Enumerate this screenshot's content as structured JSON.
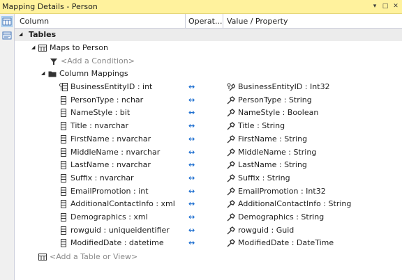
{
  "window": {
    "title": "Mapping Details - Person"
  },
  "toolbar": {
    "left_icons": [
      "map-entity-to-tables-icon",
      "map-entity-to-functions-icon"
    ]
  },
  "columns": {
    "column": "Column",
    "operator": "Operat...",
    "value": "Value / Property"
  },
  "tree": {
    "tables_label": "Tables",
    "maps_to_label": "Maps to Person",
    "add_condition": "<Add a Condition>",
    "column_mappings_label": "Column Mappings",
    "add_table": "<Add a Table or View>"
  },
  "mappings": [
    {
      "column": "BusinessEntityID : int",
      "operator": "↔",
      "property": "BusinessEntityID : Int32",
      "key": true
    },
    {
      "column": "PersonType : nchar",
      "operator": "↔",
      "property": "PersonType : String",
      "key": false
    },
    {
      "column": "NameStyle : bit",
      "operator": "↔",
      "property": "NameStyle : Boolean",
      "key": false
    },
    {
      "column": "Title : nvarchar",
      "operator": "↔",
      "property": "Title : String",
      "key": false
    },
    {
      "column": "FirstName : nvarchar",
      "operator": "↔",
      "property": "FirstName : String",
      "key": false
    },
    {
      "column": "MiddleName : nvarchar",
      "operator": "↔",
      "property": "MiddleName : String",
      "key": false
    },
    {
      "column": "LastName : nvarchar",
      "operator": "↔",
      "property": "LastName : String",
      "key": false
    },
    {
      "column": "Suffix : nvarchar",
      "operator": "↔",
      "property": "Suffix : String",
      "key": false
    },
    {
      "column": "EmailPromotion : int",
      "operator": "↔",
      "property": "EmailPromotion : Int32",
      "key": false
    },
    {
      "column": "AdditionalContactInfo : xml",
      "operator": "↔",
      "property": "AdditionalContactInfo : String",
      "key": false
    },
    {
      "column": "Demographics : xml",
      "operator": "↔",
      "property": "Demographics : String",
      "key": false
    },
    {
      "column": "rowguid : uniqueidentifier",
      "operator": "↔",
      "property": "rowguid : Guid",
      "key": false
    },
    {
      "column": "ModifiedDate : datetime",
      "operator": "↔",
      "property": "ModifiedDate : DateTime",
      "key": false
    }
  ],
  "colors": {
    "title_bar": "#fff29d",
    "operator_arrow": "#1e6fd0",
    "section_bg": "#ececec"
  }
}
